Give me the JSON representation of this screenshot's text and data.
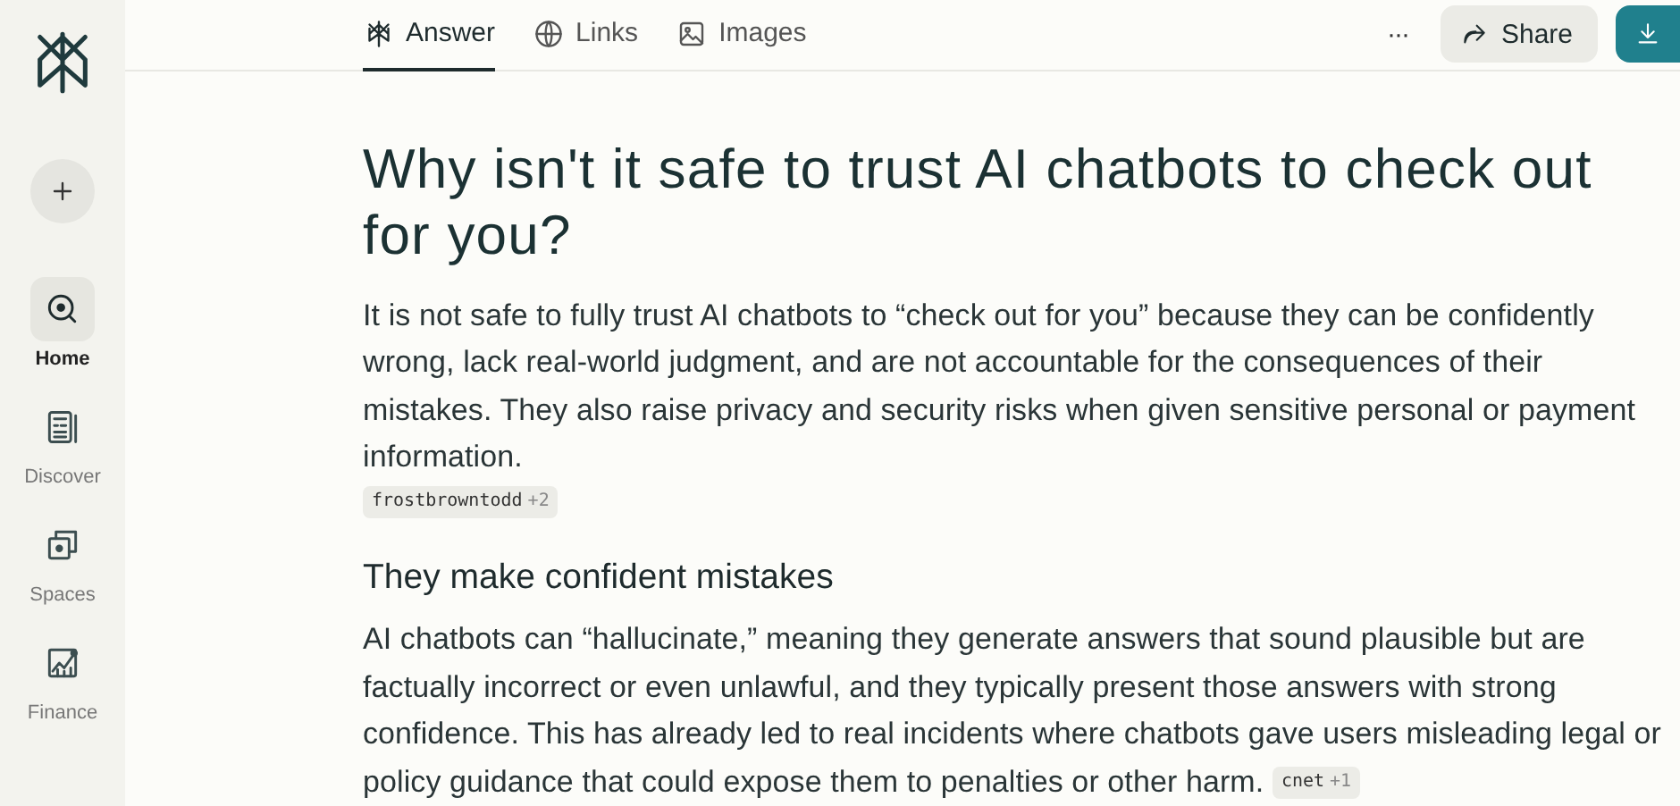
{
  "sidebar": {
    "items": [
      {
        "label": "Home",
        "selected": true
      },
      {
        "label": "Discover",
        "selected": false
      },
      {
        "label": "Spaces",
        "selected": false
      },
      {
        "label": "Finance",
        "selected": false
      }
    ]
  },
  "tabs": [
    {
      "label": "Answer",
      "selected": true
    },
    {
      "label": "Links",
      "selected": false
    },
    {
      "label": "Images",
      "selected": false
    }
  ],
  "toolbar": {
    "more": "···",
    "share": "Share"
  },
  "title": "Why isn't it safe to trust AI chatbots to check out for you?",
  "blocks": [
    {
      "kind": "paragraph",
      "text": "It is not safe to fully trust AI chatbots to “check out for you” because they can be confidently wrong, lack real-world judgment, and are not accountable for the consequences of their mistakes. They also raise privacy and security risks when given sensitive personal or payment information."
    },
    {
      "kind": "citation",
      "citation": {
        "source": "frostbrowntodd",
        "count": "+2"
      }
    },
    {
      "kind": "heading",
      "text": "They make confident mistakes"
    },
    {
      "kind": "paragraph",
      "text": "AI chatbots can “hallucinate,” meaning they generate answers that sound plausible but are factually incorrect or even unlawful, and they typically present those answers with strong confidence. This has already led to real incidents where chatbots gave users misleading legal or policy guidance that could expose them to penalties or other harm.",
      "citation": {
        "source": "cnet",
        "count": "+1"
      }
    }
  ]
}
